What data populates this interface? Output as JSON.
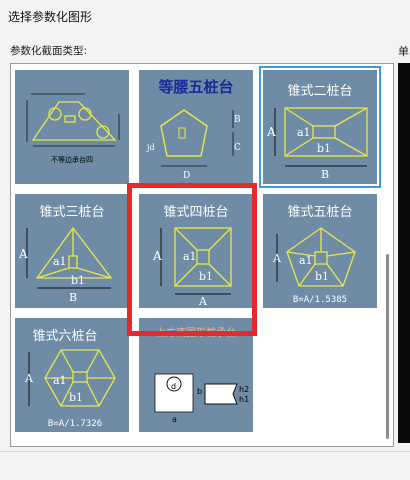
{
  "window": {
    "title": "选择参数化图形"
  },
  "section": {
    "label": "参数化截面类型:",
    "side_label": "单"
  },
  "tiles": [
    {
      "caption": "不等边承台四"
    },
    {
      "caption": "等腰五桩台",
      "labels": [
        "B",
        "C",
        "D",
        "jd"
      ]
    },
    {
      "caption": "锥式二桩台",
      "labels": [
        "A",
        "a1",
        "b1",
        "B"
      ]
    },
    {
      "caption": "锥式三桩台",
      "labels": [
        "A",
        "a1",
        "b1",
        "B"
      ]
    },
    {
      "caption": "锥式四桩台",
      "labels": [
        "A",
        "a1",
        "b1",
        "A"
      ]
    },
    {
      "caption": "锥式五桩台",
      "labels": [
        "A",
        "a1",
        "b1"
      ],
      "formula": "B=A/1.5385"
    },
    {
      "caption": "锥式六桩台",
      "labels": [
        "A",
        "a1",
        "b1"
      ],
      "formula": "B=A/1.7326"
    },
    {
      "caption": "上方底圆形桩承台",
      "labels": [
        "d",
        "b",
        "h2",
        "h1",
        "a"
      ]
    }
  ],
  "colors": {
    "tile_bg": "#6f8ba5",
    "selection": "#3a9ce0",
    "highlight": "#e52a2a",
    "drawing": "#e8e84a"
  }
}
